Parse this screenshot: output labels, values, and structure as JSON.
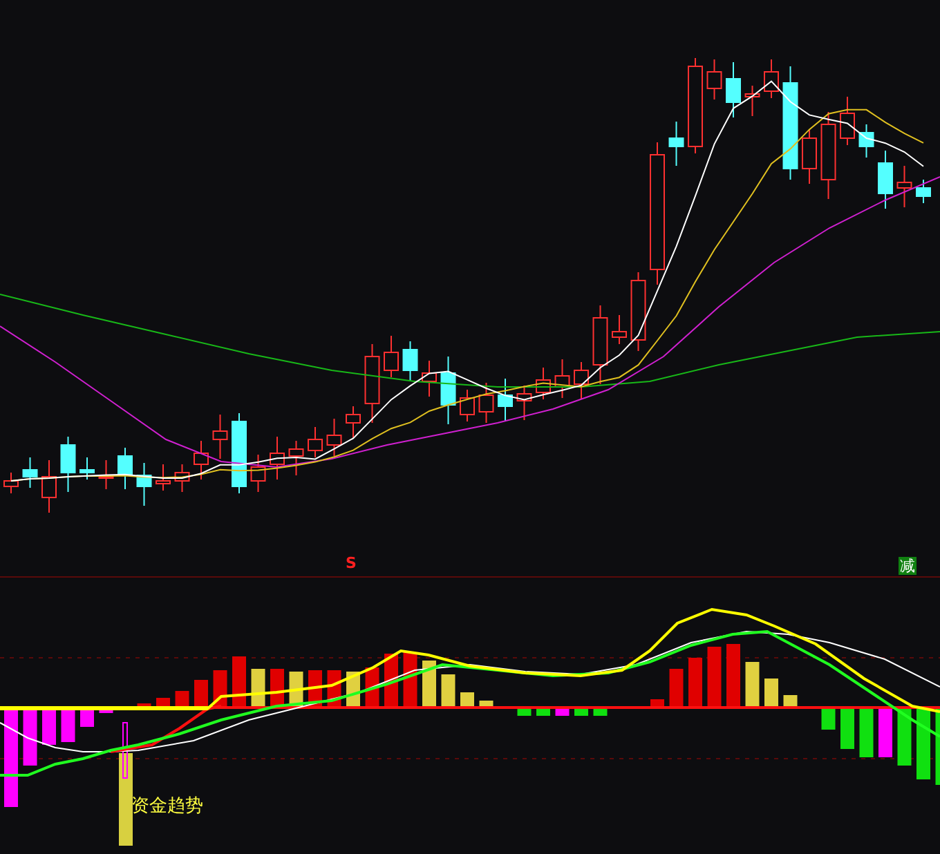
{
  "price_chart": {
    "signal_marker": "S",
    "reduce_marker": "减"
  },
  "indicator_panel": {
    "label": "资金趋势"
  }
}
